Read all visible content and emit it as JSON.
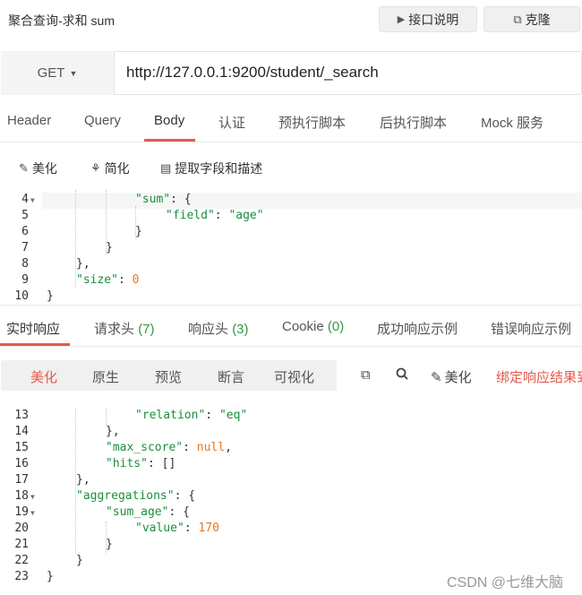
{
  "header": {
    "title": "聚合查询-求和 sum",
    "doc_button": "接口说明",
    "clone_button": "克隆"
  },
  "request": {
    "method": "GET",
    "url": "http://127.0.0.1:9200/student/_search"
  },
  "request_tabs": [
    "Header",
    "Query",
    "Body",
    "认证",
    "预执行脚本",
    "后执行脚本",
    "Mock 服务"
  ],
  "body_tools": {
    "beautify": "美化",
    "simplify": "简化",
    "extract": "提取字段和描述"
  },
  "request_code": [
    {
      "num": "4",
      "fold": true
    },
    {
      "num": "5",
      "fold": false
    },
    {
      "num": "6",
      "fold": false
    },
    {
      "num": "7",
      "fold": false
    },
    {
      "num": "8",
      "fold": false
    },
    {
      "num": "9",
      "fold": false
    },
    {
      "num": "10",
      "fold": false
    }
  ],
  "request_code_tokens": {
    "l4_key": "\"sum\"",
    "l4_rest": ": {",
    "l5_key": "\"field\"",
    "l5_sep": ": ",
    "l5_val": "\"age\"",
    "l6": "}",
    "l7": "}",
    "l8": "},",
    "l9_key": "\"size\"",
    "l9_sep": ": ",
    "l9_val": "0",
    "l10": "}"
  },
  "response_tabs": {
    "realtime": "实时响应",
    "req_headers": "请求头",
    "req_headers_count": "(7)",
    "resp_headers": "响应头",
    "resp_headers_count": "(3)",
    "cookie": "Cookie",
    "cookie_count": "(0)",
    "success_example": "成功响应示例",
    "error_example": "错误响应示例"
  },
  "view_modes": [
    "美化",
    "原生",
    "预览",
    "断言",
    "可视化"
  ],
  "response_tools": {
    "beautify": "美化",
    "bind": "绑定响应结果到"
  },
  "response_code": [
    "13",
    "14",
    "15",
    "16",
    "17",
    "18",
    "19",
    "20",
    "21",
    "22",
    "23"
  ],
  "response_tokens": {
    "l13_key": "\"relation\"",
    "l13_sep": ": ",
    "l13_val": "\"eq\"",
    "l14": "},",
    "l15_key": "\"max_score\"",
    "l15_sep": ": ",
    "l15_val": "null",
    "l15_end": ",",
    "l16_key": "\"hits\"",
    "l16_rest": ": []",
    "l17": "},",
    "l18_key": "\"aggregations\"",
    "l18_rest": ": {",
    "l19_key": "\"sum_age\"",
    "l19_rest": ": {",
    "l20_key": "\"value\"",
    "l20_sep": ": ",
    "l20_val": "170",
    "l21": "}",
    "l22": "}",
    "l23": "}"
  },
  "watermark": "CSDN @七维大脑",
  "colors": {
    "accent": "#e45a4e",
    "json_key": "#1a8f3c",
    "json_number": "#e8771e",
    "count": "#2f9a48"
  }
}
